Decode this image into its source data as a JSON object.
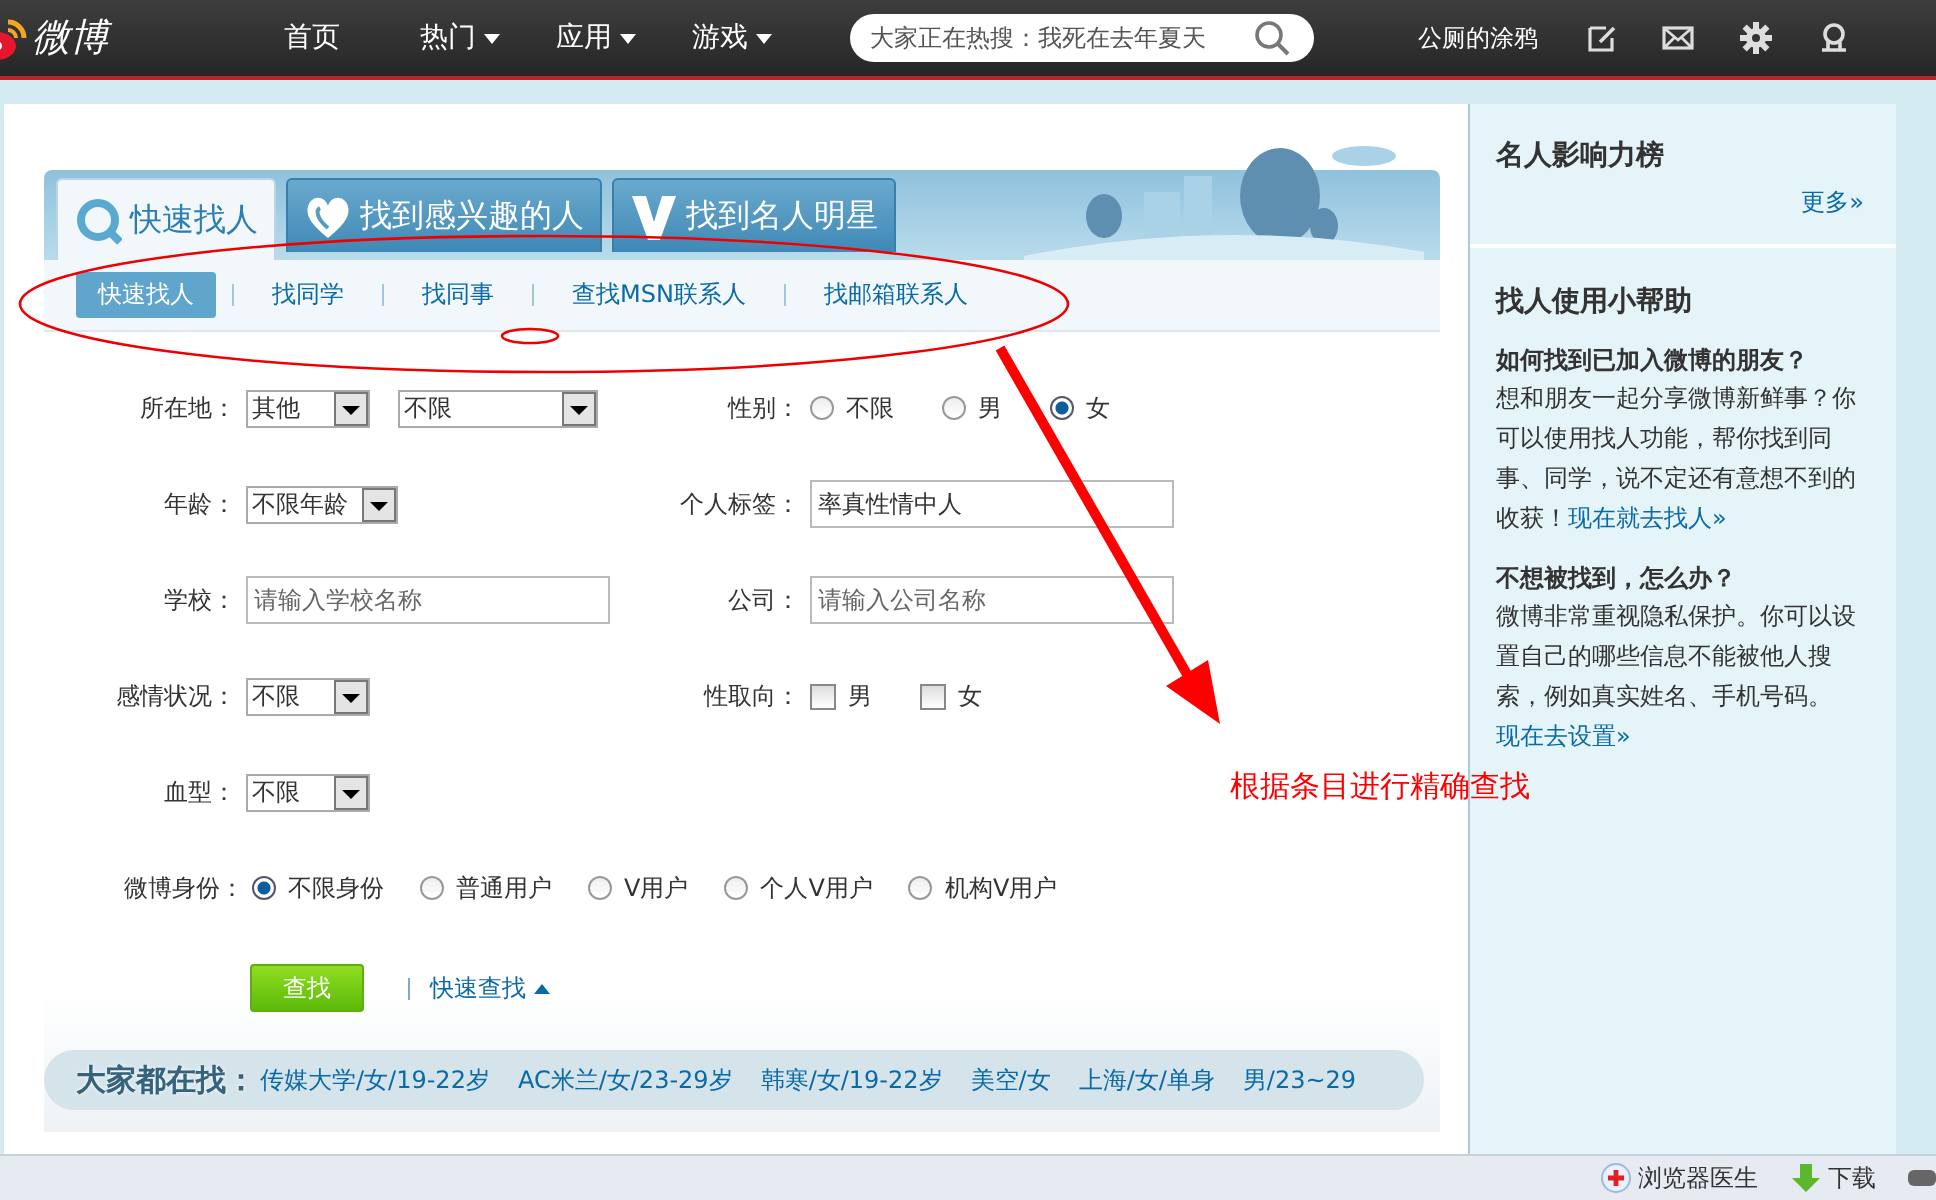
{
  "top_nav": {
    "logo_text": "微博",
    "items": [
      {
        "label": "首页",
        "has_menu": false
      },
      {
        "label": "热门",
        "has_menu": true
      },
      {
        "label": "应用",
        "has_menu": true
      },
      {
        "label": "游戏",
        "has_menu": true
      }
    ],
    "search": {
      "placeholder": "大家正在热搜：我死在去年夏天"
    },
    "username": "公厕的涂鸦"
  },
  "tabs": [
    {
      "label": "快速找人",
      "kind": "search",
      "selected": true
    },
    {
      "label": "找到感兴趣的人",
      "kind": "heart",
      "selected": false
    },
    {
      "label": "找到名人明星",
      "kind": "v",
      "selected": false
    }
  ],
  "subtabs": [
    {
      "label": "快速找人",
      "selected": true
    },
    {
      "label": "找同学",
      "selected": false
    },
    {
      "label": "找同事",
      "selected": false
    },
    {
      "label": "查找MSN联系人",
      "selected": false
    },
    {
      "label": "找邮箱联系人",
      "selected": false
    }
  ],
  "form": {
    "rows": [
      {
        "left": {
          "label": "所在地：",
          "kind": "select",
          "values": [
            "其他",
            "不限"
          ]
        },
        "right": {
          "label": "性别：",
          "kind": "radio",
          "options": [
            {
              "label": "不限",
              "selected": false
            },
            {
              "label": "男",
              "selected": false
            },
            {
              "label": "女",
              "selected": true
            }
          ]
        }
      },
      {
        "left": {
          "label": "年龄：",
          "kind": "select",
          "values": [
            "不限年龄"
          ]
        },
        "right": {
          "label": "个人标签：",
          "kind": "input",
          "value": "率真性情中人"
        }
      },
      {
        "left": {
          "label": "学校：",
          "kind": "input",
          "placeholder": "请输入学校名称"
        },
        "right": {
          "label": "公司：",
          "kind": "input",
          "placeholder": "请输入公司名称"
        }
      },
      {
        "left": {
          "label": "感情状况：",
          "kind": "select",
          "values": [
            "不限"
          ]
        },
        "right": {
          "label": "性取向：",
          "kind": "checkbox",
          "options": [
            {
              "label": "男",
              "checked": false
            },
            {
              "label": "女",
              "checked": false
            }
          ]
        }
      },
      {
        "left": {
          "label": "血型：",
          "kind": "select",
          "values": [
            "不限"
          ]
        }
      },
      {
        "wide": {
          "label": "微博身份：",
          "kind": "radio",
          "options": [
            {
              "label": "不限身份",
              "selected": true
            },
            {
              "label": "普通用户",
              "selected": false
            },
            {
              "label": "V用户",
              "selected": false
            },
            {
              "label": "个人V用户",
              "selected": false
            },
            {
              "label": "机构V用户",
              "selected": false
            }
          ]
        }
      }
    ],
    "submit": "查找",
    "quick_link": "快速查找"
  },
  "popular": {
    "title": "大家都在找：",
    "items": [
      "传媒大学/女/19-22岁",
      "AC米兰/女/23-29岁",
      "韩寒/女/19-22岁",
      "美空/女",
      "上海/女/单身",
      "男/23~29"
    ]
  },
  "sidebar": {
    "ranking": {
      "title": "名人影响力榜",
      "more": "更多»"
    },
    "help": {
      "title": "找人使用小帮助",
      "items": [
        {
          "question": "如何找到已加入微博的朋友？",
          "text": "想和朋友一起分享微博新鲜事？你可以使用找人功能，帮你找到同事、同学，说不定还有意想不到的收获！",
          "link": "现在就去找人»"
        },
        {
          "question": "不想被找到，怎么办？",
          "text": "微博非常重视隐私保护。你可以设置自己的哪些信息不能被他人搜索，例如真实姓名、手机号码。",
          "link": "现在去设置»"
        }
      ]
    }
  },
  "status_bar": {
    "items": [
      {
        "label": "浏览器医生",
        "kind": "doctor"
      },
      {
        "label": "下载",
        "kind": "download"
      }
    ]
  },
  "annotation": {
    "text": "根据条目进行精确查找"
  }
}
